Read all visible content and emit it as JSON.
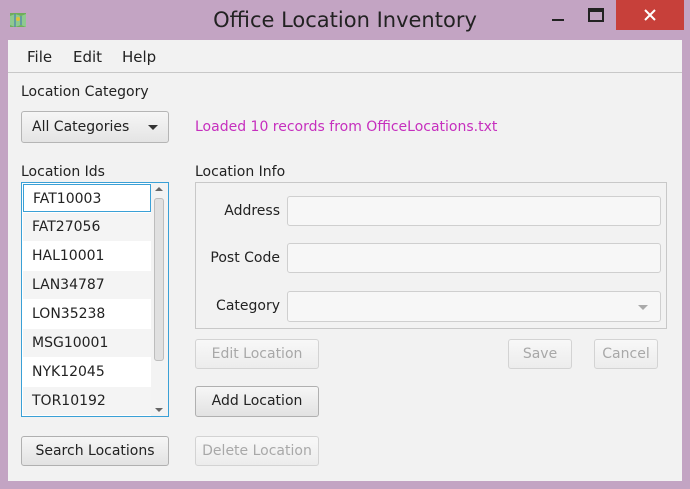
{
  "window": {
    "title": "Office Location Inventory",
    "controls": {
      "minimize": "minimize-icon",
      "maximize": "maximize-icon",
      "close": "close-icon"
    }
  },
  "menu": {
    "items": [
      "File",
      "Edit",
      "Help"
    ]
  },
  "category": {
    "label": "Location Category",
    "selected": "All Categories"
  },
  "status_message": "Loaded 10 records from OfficeLocations.txt",
  "location_ids": {
    "label": "Location Ids",
    "items": [
      "FAT10003",
      "FAT27056",
      "HAL10001",
      "LAN34787",
      "LON35238",
      "MSG10001",
      "NYK12045",
      "TOR10192"
    ]
  },
  "search_button": "Search Locations",
  "info": {
    "label": "Location Info",
    "address_label": "Address",
    "address_value": "",
    "postcode_label": "Post Code",
    "postcode_value": "",
    "category_label": "Category",
    "category_value": ""
  },
  "buttons": {
    "edit": "Edit Location",
    "save": "Save",
    "cancel": "Cancel",
    "add": "Add Location",
    "delete": "Delete Location"
  },
  "colors": {
    "status_text": "#c62fbe",
    "focus_border": "#3aa0d6",
    "close_button": "#c7403a",
    "title_bar": "#c3a4c3"
  }
}
